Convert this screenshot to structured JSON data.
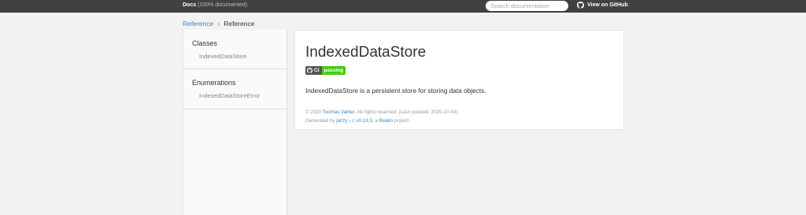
{
  "header": {
    "docs_label": "Docs",
    "coverage": "(100% documented)",
    "search_placeholder": "Search documentation",
    "github_label": "View on GitHub"
  },
  "breadcrumb": {
    "root": "Reference",
    "current": "Reference"
  },
  "sidebar": {
    "groups": [
      {
        "title": "Classes",
        "items": [
          "IndexedDataStore"
        ]
      },
      {
        "title": "Enumerations",
        "items": [
          "IndexedDataStoreError"
        ]
      }
    ]
  },
  "main": {
    "title": "IndexedDataStore",
    "badge": {
      "label": "CI",
      "status": "passing",
      "status_color": "#44cc11"
    },
    "description": "IndexedDataStore is a persistent store for storing data objects.",
    "footer": {
      "copyright_prefix": "© 2020 ",
      "author": "Toomas Vahter",
      "copyright_suffix": ". All rights reserved. (Last updated: 2020-10-04)",
      "generated_prefix": "Generated by ",
      "generator": "jazzy ♪♫ v0.13.5",
      "generated_mid": ", a ",
      "org": "Realm",
      "generated_suffix": " project."
    }
  },
  "icons": {
    "github": "github-icon"
  },
  "colors": {
    "topbar": "#414141",
    "link": "#4183c4",
    "badge_pass": "#44cc11"
  }
}
